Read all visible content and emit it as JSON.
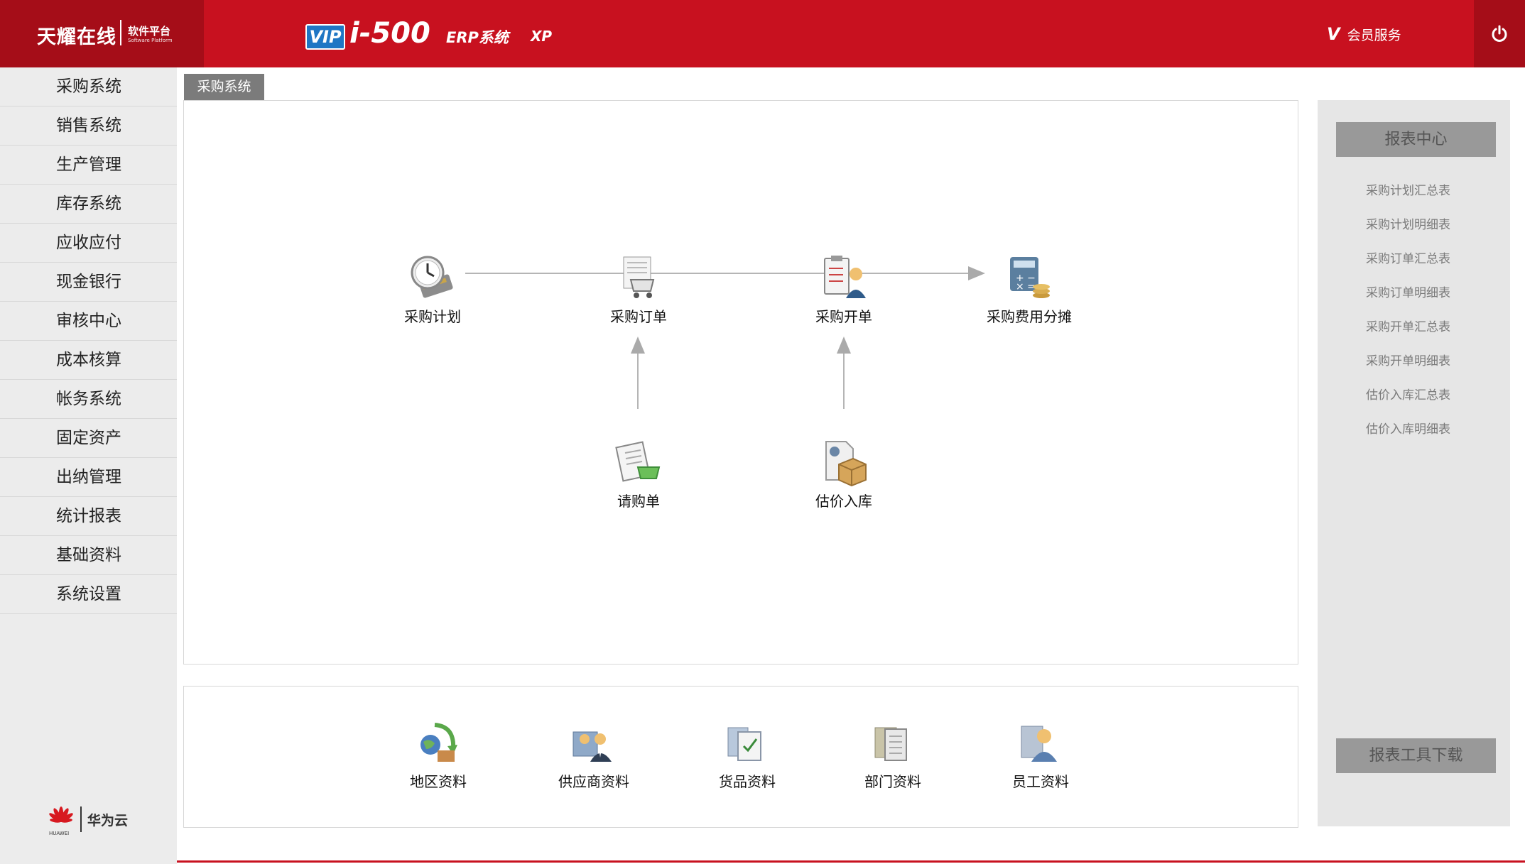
{
  "header": {
    "brand_name": "天耀在线",
    "brand_sub": "软件平台",
    "brand_sub_en": "Software Platform",
    "vip_badge": "VIP",
    "product": "i-500",
    "erp_label": "ERP系统",
    "xp_label": "XP",
    "member_v": "V",
    "member_label": "会员服务",
    "power_icon": "power-icon"
  },
  "sidebar": {
    "items": [
      {
        "label": "采购系统"
      },
      {
        "label": "销售系统"
      },
      {
        "label": "生产管理"
      },
      {
        "label": "库存系统"
      },
      {
        "label": "应收应付"
      },
      {
        "label": "现金银行"
      },
      {
        "label": "审核中心"
      },
      {
        "label": "成本核算"
      },
      {
        "label": "帐务系统"
      },
      {
        "label": "固定资产"
      },
      {
        "label": "出纳管理"
      },
      {
        "label": "统计报表"
      },
      {
        "label": "基础资料"
      },
      {
        "label": "系统设置"
      }
    ],
    "footer": {
      "logo_text": "HUAWEI",
      "name": "华为云"
    }
  },
  "main": {
    "tab_label": "采购系统",
    "flow": {
      "plan": "采购计划",
      "order": "采购订单",
      "bill": "采购开单",
      "expense": "采购费用分摊",
      "request": "请购单",
      "estimate": "估价入库"
    },
    "basics": {
      "region": "地区资料",
      "supplier": "供应商资料",
      "goods": "货品资料",
      "dept": "部门资料",
      "staff": "员工资料"
    }
  },
  "reports": {
    "title": "报表中心",
    "links": [
      "采购计划汇总表",
      "采购计划明细表",
      "采购订单汇总表",
      "采购订单明细表",
      "采购开单汇总表",
      "采购开单明细表",
      "估价入库汇总表",
      "估价入库明细表"
    ],
    "tool_button": "报表工具下载"
  },
  "colors": {
    "brand_red": "#c8111f",
    "brand_dark_red": "#a50d18",
    "vip_blue": "#1f76c4"
  }
}
